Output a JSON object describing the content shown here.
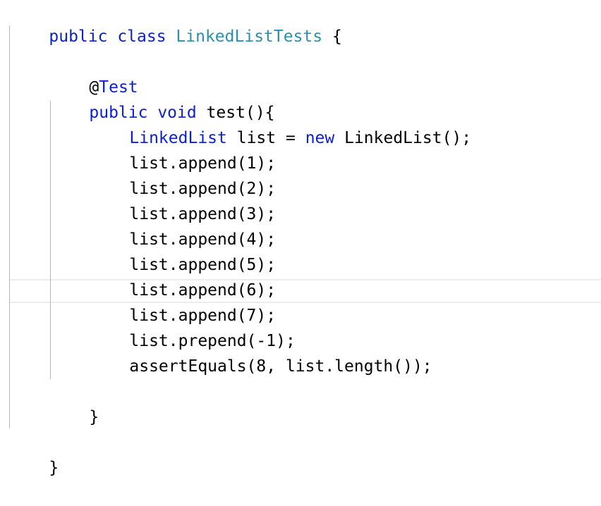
{
  "code": {
    "class_keyword": "public class",
    "class_name": "LinkedListTests",
    "class_open_brace": "{",
    "annotation": "@Test",
    "method_modifiers": "public void",
    "method_signature": "test(){",
    "line_decl_type": "LinkedList",
    "line_decl_mid": "list =",
    "line_decl_new": "new",
    "line_decl_end": "LinkedList();",
    "append_lines": [
      "list.append(1);",
      "list.append(2);",
      "list.append(3);",
      "list.append(4);",
      "list.append(5);",
      "list.append(6);",
      "list.append(7);"
    ],
    "prepend_line": "list.prepend(-1);",
    "assert_line": "assertEquals(8, list.length());",
    "method_close_brace": "}",
    "class_close_brace": "}"
  },
  "colors": {
    "keyword": "#0b1fd4",
    "type": "#2a8fb0",
    "text": "#000000",
    "indent_guide": "#b7b7b7",
    "current_line_border": "#ececec"
  }
}
